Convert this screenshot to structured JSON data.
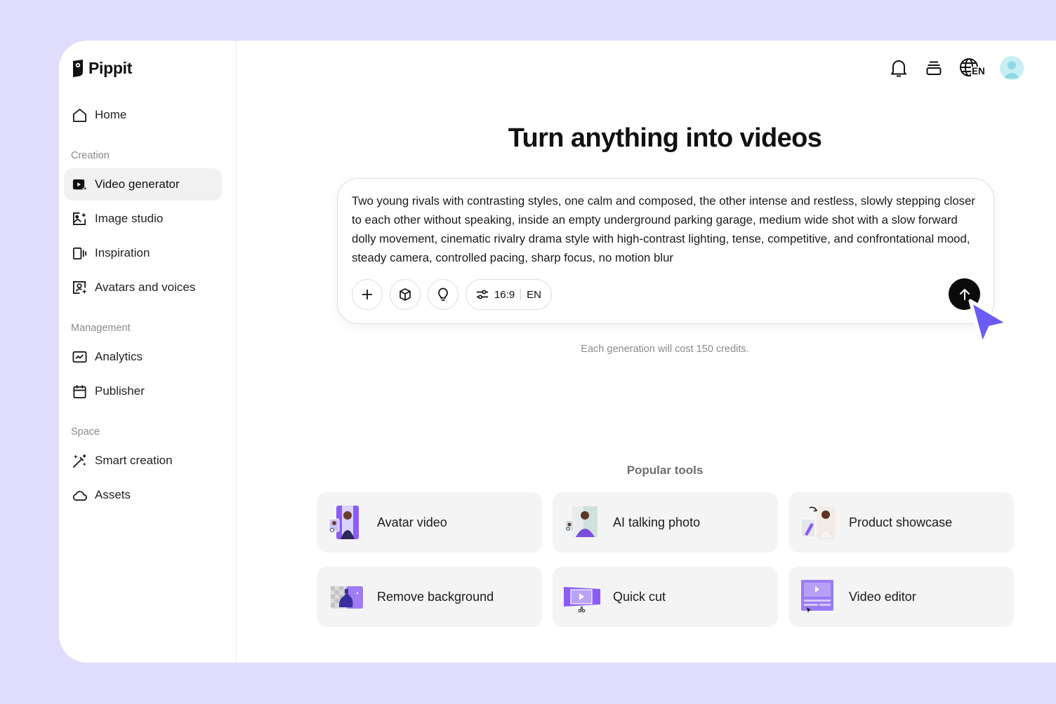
{
  "brand": {
    "name": "Pippit"
  },
  "sidebar": {
    "home": "Home",
    "sections": [
      {
        "label": "Creation",
        "items": [
          "Video generator",
          "Image studio",
          "Inspiration",
          "Avatars and voices"
        ]
      },
      {
        "label": "Management",
        "items": [
          "Analytics",
          "Publisher"
        ]
      },
      {
        "label": "Space",
        "items": [
          "Smart creation",
          "Assets"
        ]
      }
    ],
    "active_item": "Video generator"
  },
  "topbar": {
    "icons": [
      "bell-icon",
      "layers-icon",
      "globe-icon",
      "user-avatar"
    ],
    "language": "EN"
  },
  "main": {
    "title": "Turn anything into videos",
    "prompt": "Two young rivals with contrasting styles, one calm and composed, the other intense and restless, slowly stepping closer to each other without speaking, inside an empty underground parking garage, medium wide shot with a slow forward dolly movement, cinematic rivalry drama style with high-contrast lighting, tense, competitive, and confrontational mood, steady camera, controlled pacing, sharp focus, no motion blur",
    "toolbar": {
      "ratio": "16:9",
      "language": "EN"
    },
    "credits_note": "Each generation will cost 150 credits.",
    "popular_title": "Popular tools",
    "tools": [
      "Avatar video",
      "AI talking photo",
      "Product showcase",
      "Remove background",
      "Quick cut",
      "Video editor"
    ]
  },
  "colors": {
    "background": "#e0dcfb",
    "accent": "#6b5cf6",
    "send": "#0b0b0b"
  }
}
